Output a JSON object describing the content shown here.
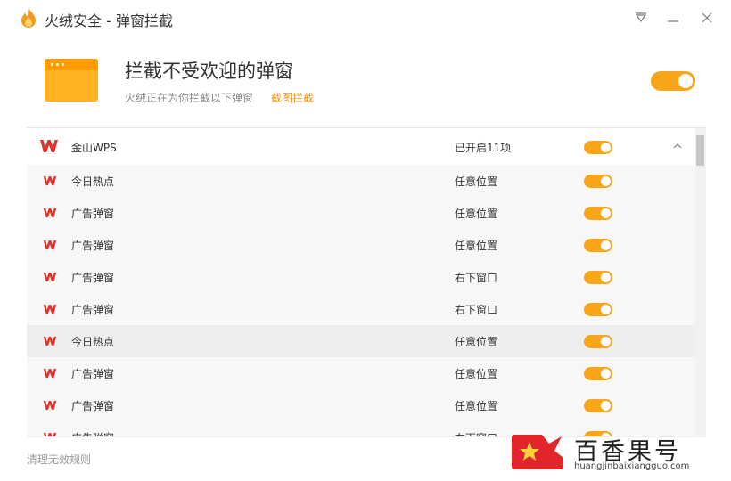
{
  "window": {
    "title": "火绒安全 - 弹窗拦截"
  },
  "hero": {
    "title": "拦截不受欢迎的弹窗",
    "subtitle": "火绒正在为你拦截以下弹窗",
    "link": "截图拦截",
    "toggle_on": true
  },
  "list": {
    "group": {
      "icon": "wps-icon",
      "name": "金山WPS",
      "status": "已开启11项",
      "toggle_on": true,
      "expanded": true
    },
    "items": [
      {
        "icon": "wps-icon",
        "name": "今日热点",
        "position": "任意位置",
        "toggle_on": true
      },
      {
        "icon": "wps-icon",
        "name": "广告弹窗",
        "position": "任意位置",
        "toggle_on": true
      },
      {
        "icon": "wps-icon",
        "name": "广告弹窗",
        "position": "任意位置",
        "toggle_on": true
      },
      {
        "icon": "wps-icon",
        "name": "广告弹窗",
        "position": "右下窗口",
        "toggle_on": true
      },
      {
        "icon": "wps-icon",
        "name": "广告弹窗",
        "position": "右下窗口",
        "toggle_on": true
      },
      {
        "icon": "wps-icon",
        "name": "今日热点",
        "position": "任意位置",
        "toggle_on": true
      },
      {
        "icon": "wps-icon",
        "name": "广告弹窗",
        "position": "任意位置",
        "toggle_on": true
      },
      {
        "icon": "wps-icon",
        "name": "广告弹窗",
        "position": "任意位置",
        "toggle_on": true
      },
      {
        "icon": "wps-icon",
        "name": "广告弹窗",
        "position": "右下窗口",
        "toggle_on": true
      }
    ]
  },
  "footer": {
    "link": "清理无效规则"
  },
  "watermark": {
    "name": "百香果号",
    "url": "huangjinbaixiangguo.com"
  },
  "colors": {
    "accent": "#f9a51a",
    "link": "#f0931a",
    "wps_red": "#e0332c"
  }
}
